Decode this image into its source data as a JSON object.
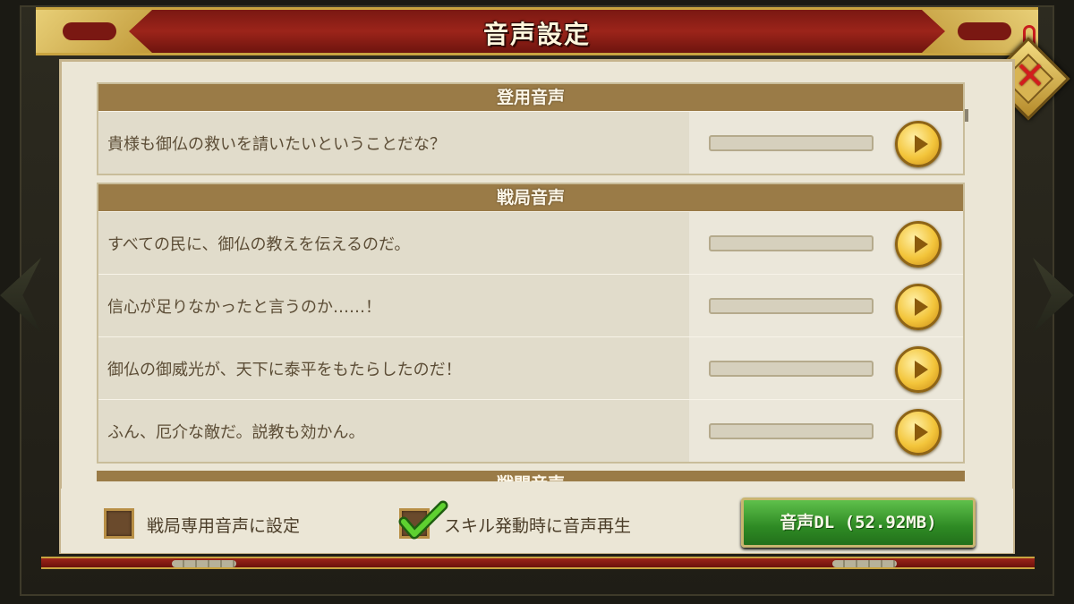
{
  "window": {
    "title": "音声設定"
  },
  "sections": [
    {
      "header": "登用音声",
      "lines": [
        {
          "text": "貴様も御仏の救いを請いたいということだな？",
          "progress": 0
        }
      ]
    },
    {
      "header": "戦局音声",
      "lines": [
        {
          "text": "すべての民に、御仏の教えを伝えるのだ。",
          "progress": 0
        },
        {
          "text": "信心が足りなかったと言うのか……！",
          "progress": 0
        },
        {
          "text": "御仏の御威光が、天下に泰平をもたらしたのだ！",
          "progress": 0
        },
        {
          "text": "ふん、厄介な敵だ。説教も効かん。",
          "progress": 0
        }
      ]
    },
    {
      "header": "戦闘音声",
      "lines": []
    }
  ],
  "footer": {
    "option1": {
      "label": "戦局専用音声に設定",
      "checked": false
    },
    "option2": {
      "label": "スキル発動時に音声再生",
      "checked": true
    },
    "download_button": "音声DL (52.92MB)"
  },
  "icons": {
    "close": "close-icon",
    "play": "play-icon",
    "check": "check-icon",
    "nav_left": "arrow-left-icon",
    "nav_right": "arrow-right-icon"
  },
  "colors": {
    "banner": "#9c241a",
    "gold": "#c9a440",
    "section_header": "#9a7b47",
    "parchment": "#ebe6d6",
    "button_green": "#2e8a24",
    "check_green": "#5ed130",
    "close_red": "#d21d1d"
  }
}
